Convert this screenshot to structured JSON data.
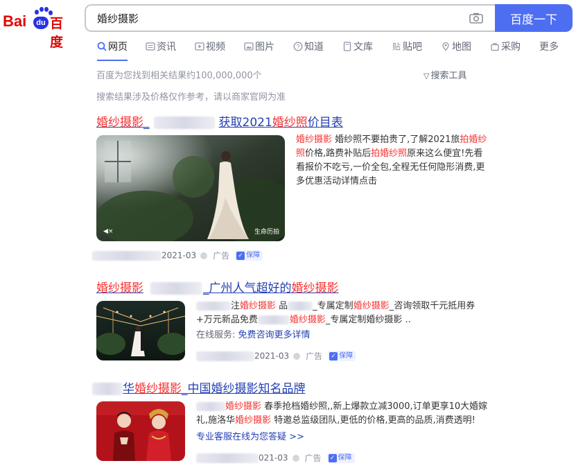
{
  "logo": {
    "bai": "Bai",
    "du": "du",
    "baidu": "百度"
  },
  "search": {
    "query": "婚纱摄影",
    "button": "百度一下"
  },
  "tabs": [
    {
      "label": "网页",
      "icon": "search-icon"
    },
    {
      "label": "资讯",
      "icon": "news-icon"
    },
    {
      "label": "视频",
      "icon": "video-icon"
    },
    {
      "label": "图片",
      "icon": "image-icon"
    },
    {
      "label": "知道",
      "icon": "question-icon"
    },
    {
      "label": "文库",
      "icon": "document-icon"
    },
    {
      "label": "贴吧",
      "icon": "tieba-icon"
    },
    {
      "label": "地图",
      "icon": "map-icon"
    },
    {
      "label": "采购",
      "icon": "shopping-icon"
    },
    {
      "label": "更多",
      "icon": ""
    }
  ],
  "stats": {
    "count": "百度为您找到相关结果约100,000,000个",
    "tools": "搜索工具"
  },
  "notice": "搜索结果涉及价格仅作参考，请以商家官网为准",
  "results": [
    {
      "title_em": "婚纱摄影",
      "title_sep": "_",
      "title_rest": "获取2021",
      "title_em2": "婚纱照",
      "title_rest2": "价目表",
      "desc": [
        {
          "t": "婚纱摄影",
          "em": true
        },
        {
          "t": " 婚纱照不要拍贵了,了解2021旅",
          "em": false
        },
        {
          "t": "拍婚纱照",
          "em": true
        },
        {
          "t": "价格,路费补贴后",
          "em": false
        },
        {
          "t": "拍婚纱照",
          "em": true
        },
        {
          "t": "原来这么便宜!先看看报价不吃亏,一价全包,全程无任何隐形消费,更多优惠活动详情点击",
          "em": false
        }
      ],
      "video_overlay": "生命历拍",
      "date": "2021-03",
      "ad": "广告",
      "badge": "保障"
    },
    {
      "title_em": "婚纱摄影",
      "title_sep": "_",
      "title_rest": "广州人气超好的",
      "title_em2": "婚纱摄影",
      "desc_line1_a": "注",
      "desc_line1_em": "婚纱摄影",
      "desc_line1_b": " 品",
      "desc_line1_c": "_专属定制",
      "desc_line1_em2": "婚纱摄影",
      "desc_line1_d": "_咨询领取千元抵用券",
      "desc_line2_a": "+万元新品免费",
      "desc_line2_em": "婚纱摄影",
      "desc_line2_b": "_专属定制婚纱摄影 ..",
      "service_label": "在线服务:",
      "service_link": "免费咨询更多详情",
      "date": "2021-03",
      "ad": "广告",
      "badge": "保障"
    },
    {
      "title_a": "华",
      "title_em": "婚纱摄影",
      "title_rest": "_中国婚纱摄影知名品牌",
      "desc_line1_em": "婚纱摄影",
      "desc_line1_a": " 春季抢档婚纱照,,新上爆款立减3000,订单更享10大婚嫁",
      "desc_line2_a": "礼,施洛华",
      "desc_line2_em": "婚纱摄影",
      "desc_line2_b": " 特邀总监级团队,更低的价格,更高的品质,消费透明!",
      "service_link": "专业客服在线为您答疑 >>",
      "date": "021-03",
      "ad": "广告",
      "badge": "保障"
    }
  ]
}
